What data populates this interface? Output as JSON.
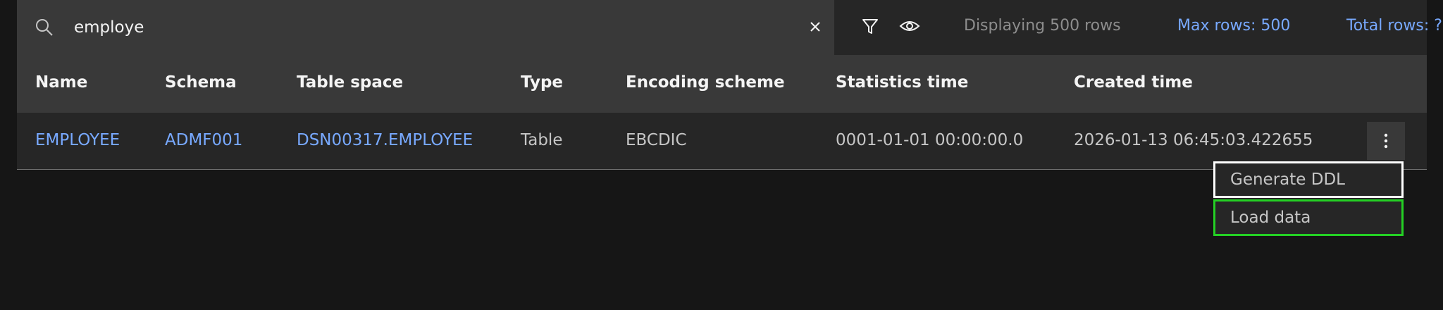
{
  "search": {
    "value": "employe"
  },
  "toolbar": {
    "displaying": "Displaying 500 rows",
    "max_rows": "Max rows: 500",
    "total_rows": "Total rows: ?"
  },
  "table": {
    "columns": [
      "Name",
      "Schema",
      "Table space",
      "Type",
      "Encoding scheme",
      "Statistics time",
      "Created time"
    ],
    "rows": [
      {
        "name": "EMPLOYEE",
        "schema": "ADMF001",
        "tablespace": "DSN00317.EMPLOYEE",
        "type": "Table",
        "encoding": "EBCDIC",
        "stats_time": "0001-01-01 00:00:00.0",
        "created_time": "2026-01-13 06:45:03.422655"
      }
    ]
  },
  "menu": {
    "items": [
      "Generate DDL",
      "Load data"
    ]
  },
  "colors": {
    "background": "#161616",
    "link": "#78a9ff",
    "highlight": "#24d024"
  }
}
